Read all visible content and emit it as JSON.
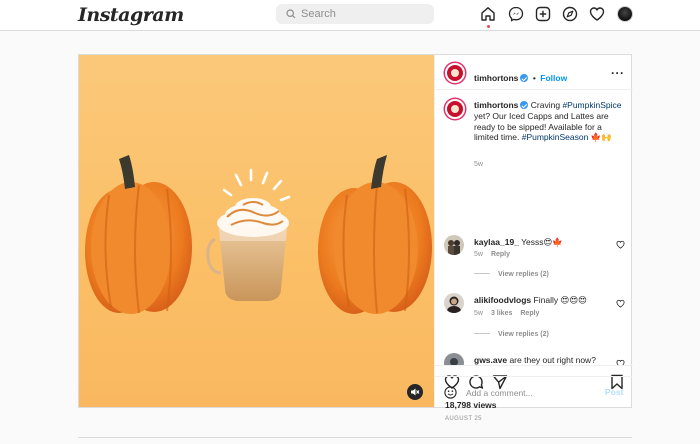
{
  "header": {
    "logo": "Instagram",
    "search_placeholder": "Search"
  },
  "post": {
    "author": {
      "username": "timhortons",
      "follow_label": "Follow"
    },
    "caption": {
      "username": "timhortons",
      "text_before": "Craving",
      "hashtag1": "#PumpkinSpice",
      "text_after": "yet? Our Iced Capps and Lattes are ready to be sipped! Available for a limited time.",
      "hashtag2": "#PumpkinSeason",
      "emoji": "🍁🙌",
      "time": "5w"
    },
    "comments": [
      {
        "username": "kaylaa_19_",
        "text": "Yesss😍🍁",
        "time": "5w",
        "likes": "",
        "reply_label": "Reply",
        "view_replies": "View replies (2)"
      },
      {
        "username": "alikifoodvlogs",
        "text": "Finally 😍😍😍",
        "time": "5w",
        "likes": "3 likes",
        "reply_label": "Reply",
        "view_replies": "View replies (2)"
      },
      {
        "username": "gws.ave",
        "text": "are they out right now?"
      }
    ],
    "views": "18,798 views",
    "date": "AUGUST 25",
    "comment_placeholder": "Add a comment...",
    "post_label": "Post"
  },
  "colors": {
    "accent": "#0095f6",
    "background": "#fbc87a",
    "notification": "#ed4956"
  }
}
